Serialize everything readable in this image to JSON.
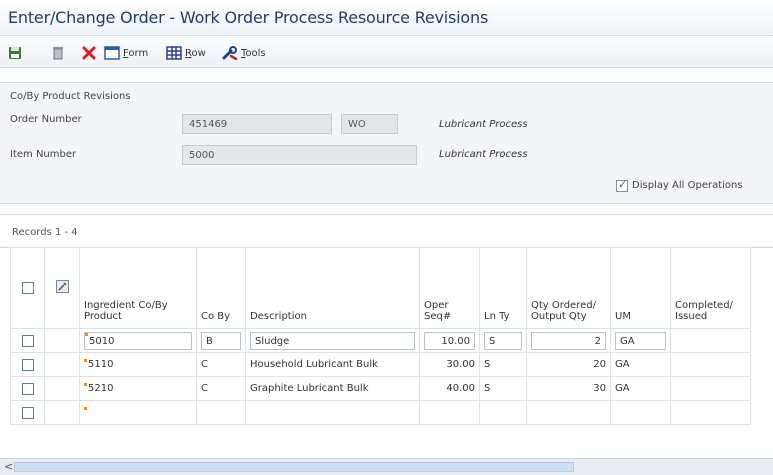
{
  "window": {
    "title": "Enter/Change Order - Work Order Process Resource Revisions"
  },
  "toolbar": {
    "save_icon": "save-icon",
    "delete_icon": "trash-icon",
    "cancel_icon": "close-icon",
    "form_label_u": "F",
    "form_label_rest": "orm",
    "row_label_u": "R",
    "row_label_rest": "ow",
    "tools_label_u": "T",
    "tools_label_rest": "ools"
  },
  "header": {
    "section_title": "Co/By Product Revisions",
    "order_number_label": "Order Number",
    "order_number_value": "451469",
    "order_type_value": "WO",
    "order_description": "Lubricant Process",
    "item_number_label": "Item Number",
    "item_number_value": "5000",
    "item_description": "Lubricant Process",
    "display_all_label": "Display All Operations",
    "display_all_checked": true
  },
  "grid": {
    "records_label": "Records 1 - 4",
    "columns": {
      "ingredient": "Ingredient Co/By Product",
      "coby": "Co By",
      "description": "Description",
      "oper_seq": "Oper Seq#",
      "ln_ty": "Ln Ty",
      "qty": "Qty Ordered/ Output Qty",
      "um": "UM",
      "completed": "Completed/ Issued"
    },
    "rows": [
      {
        "ingredient": "5010",
        "coby": "B",
        "description": "Sludge",
        "oper_seq": "10.00",
        "ln_ty": "S",
        "qty": "2",
        "um": "GA",
        "completed": ""
      },
      {
        "ingredient": "5110",
        "coby": "C",
        "description": "Household Lubricant Bulk",
        "oper_seq": "30.00",
        "ln_ty": "S",
        "qty": "20",
        "um": "GA",
        "completed": ""
      },
      {
        "ingredient": "5210",
        "coby": "C",
        "description": "Graphite Lubricant Bulk",
        "oper_seq": "40.00",
        "ln_ty": "S",
        "qty": "30",
        "um": "GA",
        "completed": ""
      },
      {
        "ingredient": "",
        "coby": "",
        "description": "",
        "oper_seq": "",
        "ln_ty": "",
        "qty": "",
        "um": "",
        "completed": ""
      }
    ]
  },
  "scrollbar": {
    "left_arrow": "<"
  }
}
